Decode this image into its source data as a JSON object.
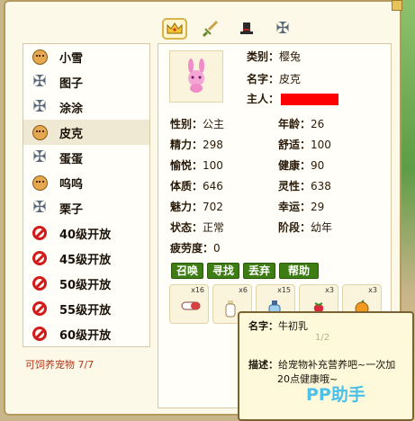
{
  "tabs": [
    {
      "icon": "crown-icon",
      "label": "宠物信息"
    },
    {
      "icon": "sword-icon",
      "label": "战斗"
    },
    {
      "icon": "top-hat-icon",
      "label": "装扮"
    },
    {
      "icon": "shuriken-icon",
      "label": "技能"
    }
  ],
  "pets": [
    {
      "name": "小雪",
      "icon": "face"
    },
    {
      "name": "图子",
      "icon": "shuriken"
    },
    {
      "name": "涂涂",
      "icon": "shuriken"
    },
    {
      "name": "皮克",
      "icon": "face",
      "selected": true
    },
    {
      "name": "蛋蛋",
      "icon": "shuriken"
    },
    {
      "name": "呜呜",
      "icon": "face"
    },
    {
      "name": "栗子",
      "icon": "shuriken"
    },
    {
      "name": "40级开放",
      "icon": "ban"
    },
    {
      "name": "45级开放",
      "icon": "ban"
    },
    {
      "name": "50级开放",
      "icon": "ban"
    },
    {
      "name": "55级开放",
      "icon": "ban"
    },
    {
      "name": "60级开放",
      "icon": "ban"
    }
  ],
  "raisable": "可饲养宠物 7/7",
  "info": {
    "type_label": "类别：",
    "type": "樱兔",
    "name_label": "名字：",
    "name": "皮克",
    "owner_label": "主人："
  },
  "stats": {
    "gender_label": "性别：",
    "gender": "公主",
    "age_label": "年龄：",
    "age": "26",
    "energy_label": "精力：",
    "energy": "298",
    "comfort_label": "舒适：",
    "comfort": "100",
    "happy_label": "愉悦：",
    "happy": "100",
    "health_label": "健康：",
    "health": "90",
    "physique_label": "体质：",
    "physique": "646",
    "spirit_label": "灵性：",
    "spirit": "638",
    "charm_label": "魅力：",
    "charm": "702",
    "luck_label": "幸运：",
    "luck": "29",
    "status_label": "状态：",
    "status": "正常",
    "stage_label": "阶段：",
    "stage": "幼年",
    "fatigue_label": "疲劳度：",
    "fatigue": "0"
  },
  "actions": {
    "summon": "召唤",
    "find": "寻找",
    "discard": "丢弃",
    "help": "帮助"
  },
  "items": [
    {
      "count": "x16",
      "icon": "pill"
    },
    {
      "count": "x6",
      "icon": "milk"
    },
    {
      "count": "x15",
      "icon": "bottle"
    },
    {
      "count": "x3",
      "icon": "strawberry"
    },
    {
      "count": "x3",
      "icon": "orange"
    }
  ],
  "tooltip": {
    "name_label": "名字：",
    "name": "牛初乳",
    "page": "1/2",
    "desc_label": "描述：",
    "desc_line1": "给宠物补充营养吧~一次加",
    "desc_line2": "20点健康哦~"
  },
  "watermark": "PP助手",
  "colors": {
    "owner_redact": "#ff0000",
    "button_green": "#3d7d14",
    "warning_text": "#b03818"
  }
}
